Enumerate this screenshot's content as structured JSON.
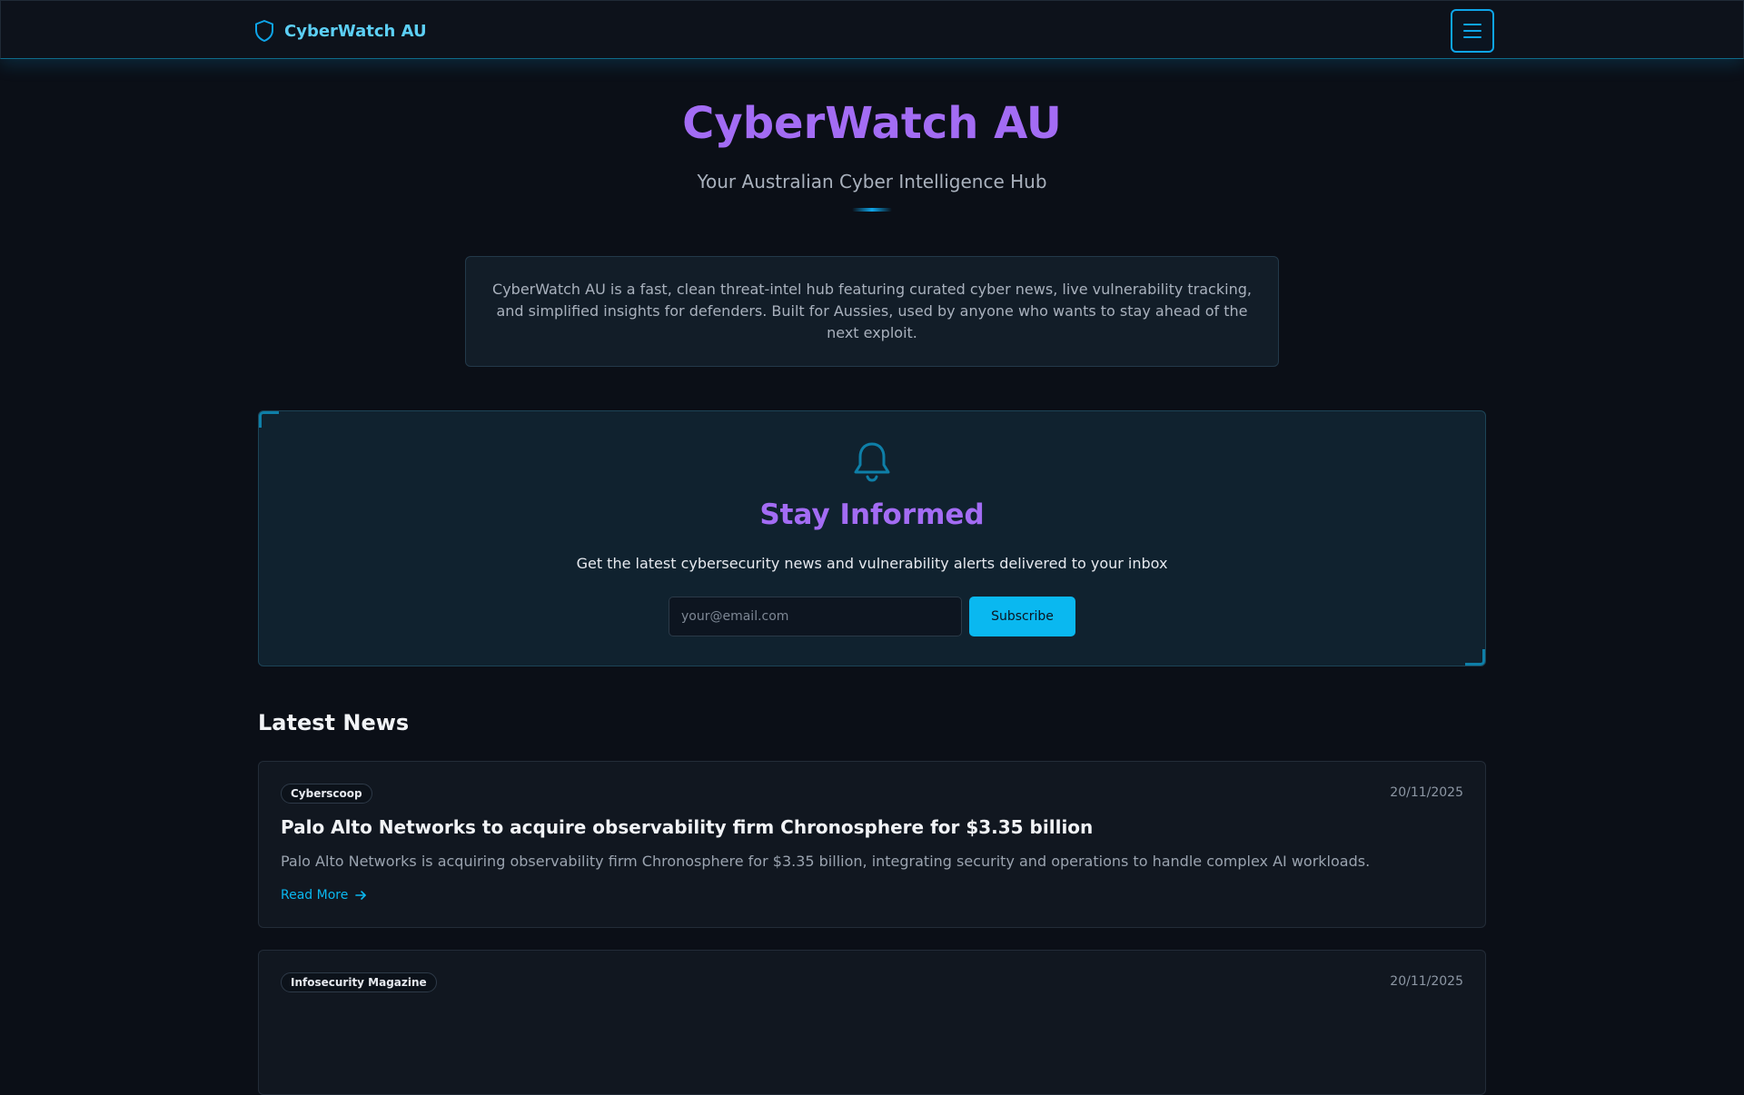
{
  "nav": {
    "brand": "CyberWatch AU",
    "brand_icon": "shield-icon",
    "menu_icon": "hamburger-menu-icon"
  },
  "hero": {
    "title": "CyberWatch AU",
    "subtitle": "Your Australian Cyber Intelligence Hub"
  },
  "about": {
    "text": "CyberWatch AU is a fast, clean threat-intel hub featuring curated cyber news, live vulnerability tracking, and simplified insights for defenders. Built for Aussies, used by anyone who wants to stay ahead of the next exploit."
  },
  "subscribe": {
    "icon": "bell-icon",
    "title": "Stay Informed",
    "description": "Get the latest cybersecurity news and vulnerability alerts delivered to your inbox",
    "email_placeholder": "your@email.com",
    "email_value": "",
    "button_label": "Subscribe"
  },
  "news": {
    "heading": "Latest News",
    "items": [
      {
        "source": "Cyberscoop",
        "date": "20/11/2025",
        "title": "Palo Alto Networks to acquire observability firm Chronosphere for $3.35 billion",
        "summary": "Palo Alto Networks is acquiring observability firm Chronosphere for $3.35 billion, integrating security and operations to handle complex AI workloads.",
        "link_label": "Read More"
      },
      {
        "source": "Infosecurity Magazine",
        "date": "20/11/2025",
        "title": "",
        "summary": "",
        "link_label": ""
      }
    ]
  },
  "colors": {
    "accent_cyan": "#0ab8f0",
    "accent_purple": "#a36cf4",
    "background": "#0b0f17",
    "card": "#111720"
  }
}
